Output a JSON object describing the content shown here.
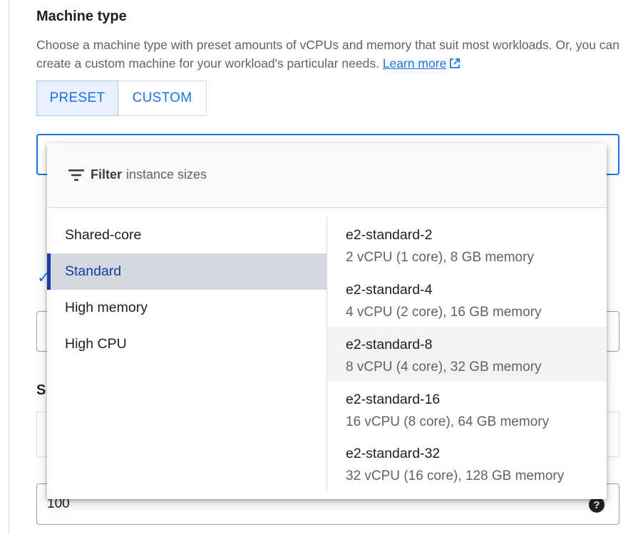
{
  "section": {
    "title": "Machine type",
    "description": "Choose a machine type with preset amounts of vCPUs and memory that suit most workloads. Or, you can create a custom machine for your workload's particular needs.",
    "learn_more": "Learn more"
  },
  "segmented": {
    "preset": "PRESET",
    "custom": "CUSTOM",
    "selected": "PRESET"
  },
  "background": {
    "partial_heading": "S",
    "field_value": "100",
    "help_glyph": "?"
  },
  "dropdown": {
    "filter_label": "Filter",
    "filter_placeholder": "instance sizes",
    "categories": [
      "Shared-core",
      "Standard",
      "High memory",
      "High CPU"
    ],
    "selected_category": "Standard",
    "options": [
      {
        "name": "e2-standard-2",
        "desc": "2 vCPU (1 core), 8 GB memory"
      },
      {
        "name": "e2-standard-4",
        "desc": "4 vCPU (2 core), 16 GB memory"
      },
      {
        "name": "e2-standard-8",
        "desc": "8 vCPU (4 core), 32 GB memory"
      },
      {
        "name": "e2-standard-16",
        "desc": "16 vCPU (8 core), 64 GB memory"
      },
      {
        "name": "e2-standard-32",
        "desc": "32 vCPU (16 core), 128 GB memory"
      }
    ],
    "hovered_option": "e2-standard-8"
  },
  "colors": {
    "accent": "#1a73e8",
    "selected_text": "#1a3aa8",
    "selected_bg": "#d3d7de"
  }
}
